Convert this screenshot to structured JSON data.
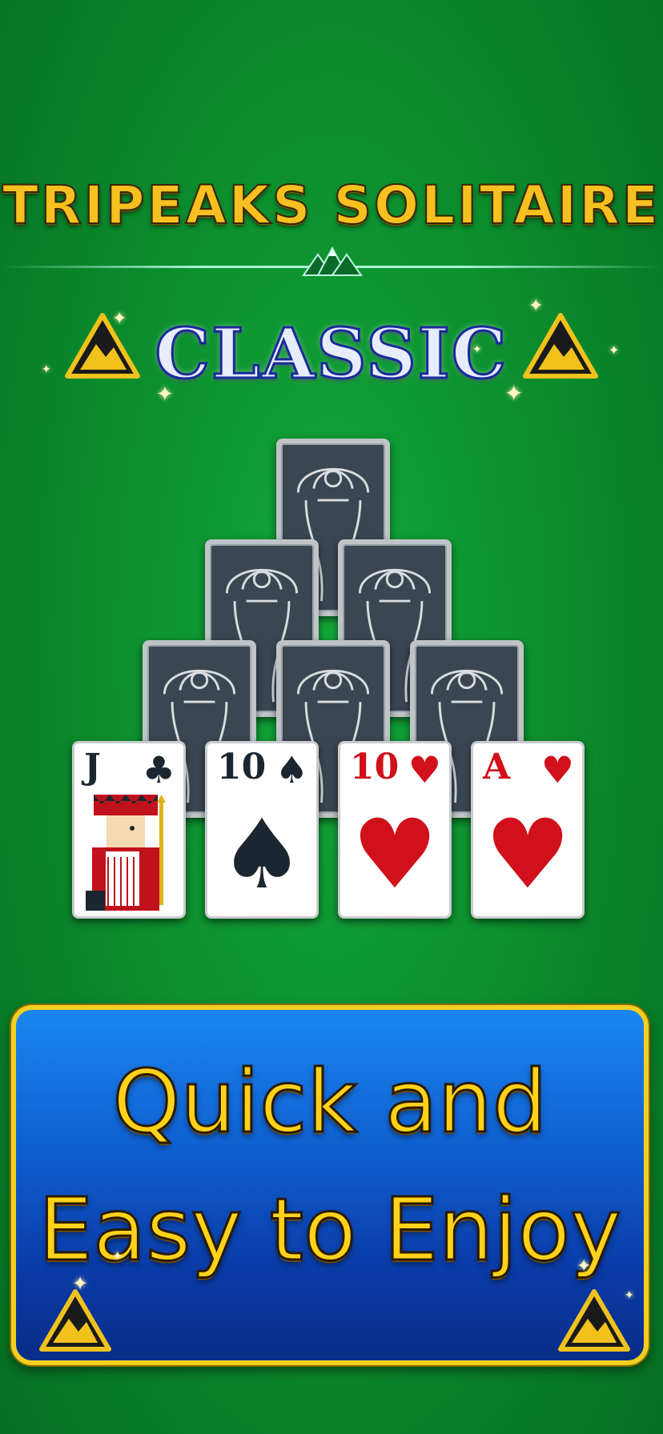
{
  "header": {
    "title": "TRIPEAKS SOLITAIRE",
    "subtitle": "CLASSIC"
  },
  "cards": {
    "face_up": [
      {
        "rank": "J",
        "suit": "♣",
        "color": "black"
      },
      {
        "rank": "10",
        "suit": "♠",
        "color": "black"
      },
      {
        "rank": "10",
        "suit": "♥",
        "color": "red"
      },
      {
        "rank": "A",
        "suit": "♥",
        "color": "red"
      }
    ]
  },
  "banner": {
    "line1": "Quick and",
    "line2": "Easy to Enjoy"
  },
  "colors": {
    "felt_green": "#0c8f2e",
    "gold": "#f6c020",
    "banner_blue": "#0f5fd0",
    "heart_red": "#d0101a"
  }
}
